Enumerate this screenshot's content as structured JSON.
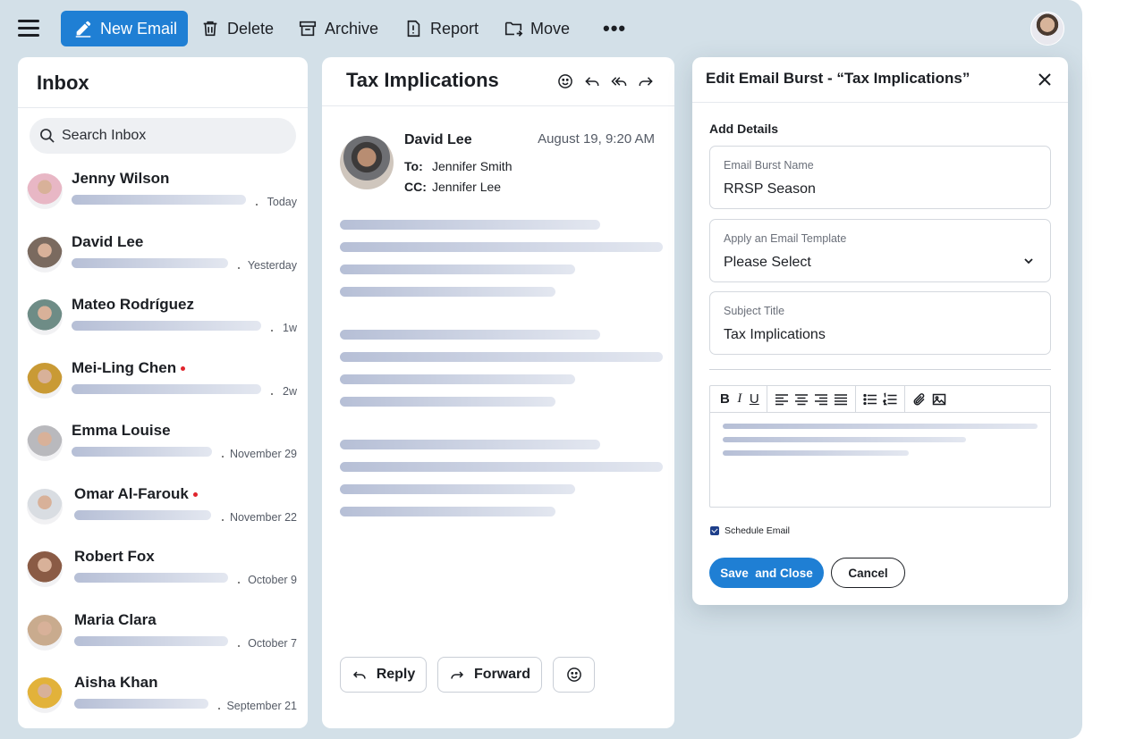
{
  "toolbar": {
    "new_email": "New Email",
    "delete": "Delete",
    "archive": "Archive",
    "report": "Report",
    "move": "Move",
    "more": "•••"
  },
  "colors": {
    "accent": "#1f7fd4",
    "background": "#d3e0e8",
    "unread_dot": "#e0242c",
    "checkbox": "#1e3f8a"
  },
  "inbox": {
    "title": "Inbox",
    "search_placeholder": "Search Inbox",
    "items": [
      {
        "name": "Jenny Wilson",
        "time": "Today",
        "unread": false,
        "avatar": "#e8b7c5"
      },
      {
        "name": "David Lee",
        "time": "Yesterday",
        "unread": false,
        "avatar": "#7a6a5f"
      },
      {
        "name": "Mateo Rodríguez",
        "time": "1w",
        "unread": false,
        "avatar": "#6e8c86"
      },
      {
        "name": "Mei-Ling Chen",
        "time": "2w",
        "unread": true,
        "avatar": "#c99a35"
      },
      {
        "name": "Emma Louise",
        "time": "November 29",
        "unread": false,
        "avatar": "#b9b9bd"
      },
      {
        "name": "Omar Al-Farouk",
        "time": "November 22",
        "unread": true,
        "avatar": "#d9dde2"
      },
      {
        "name": "Robert Fox",
        "time": "October 9",
        "unread": false,
        "avatar": "#8a5b45"
      },
      {
        "name": "Maria Clara",
        "time": "October 7",
        "unread": false,
        "avatar": "#c9ab8e"
      },
      {
        "name": "Aisha Khan",
        "time": "September 21",
        "unread": false,
        "avatar": "#e2b23a"
      }
    ]
  },
  "message": {
    "subject": "Tax Implications",
    "sender": "David Lee",
    "date": "August 19, 9:20 AM",
    "to_label": "To:",
    "to": "Jennifer Smith",
    "cc_label": "CC:",
    "cc": "Jennifer Lee",
    "reply": "Reply",
    "forward": "Forward"
  },
  "editor": {
    "title": "Edit Email Burst - “Tax Implications”",
    "section": "Add Details",
    "burst_name_label": "Email Burst Name",
    "burst_name_value": "RRSP Season",
    "template_label": "Apply an Email Template",
    "template_value": "Please Select",
    "subject_label": "Subject Title",
    "subject_value": "Tax Implications",
    "bold": "B",
    "italic": "I",
    "underline": "U",
    "schedule": "Schedule Email",
    "schedule_checked": true,
    "save": "Save  and Close",
    "cancel": "Cancel"
  }
}
